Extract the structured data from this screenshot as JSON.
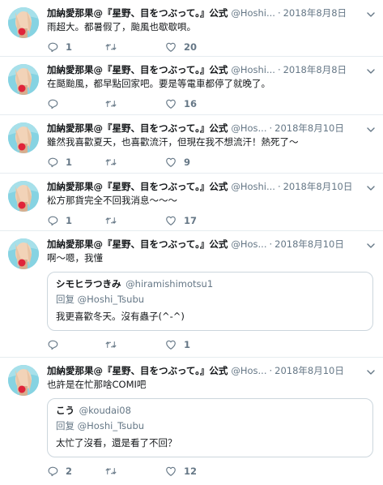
{
  "tweets": [
    {
      "name": "加納愛那果@『星野、目をつぶって。』公式",
      "handle": "@Hoshi...",
      "date": "2018年8月8日",
      "text": "雨超大。都暑假了，颱風也歇歇唄。",
      "replies": "1",
      "retweets": "",
      "likes": "20"
    },
    {
      "name": "加納愛那果@『星野、目をつぶって。』公式",
      "handle": "@Hoshi...",
      "date": "2018年8月8日",
      "text": "在颳颱風，都早點回家吧。要是等電車都停了就晚了。",
      "replies": "",
      "retweets": "",
      "likes": "16"
    },
    {
      "name": "加納愛那果@『星野、目をつぶって。』公式",
      "handle": "@Hos...",
      "date": "2018年8月10日",
      "text": "雖然我喜歡夏天，也喜歡流汗，但現在我不想流汗！熱死了～",
      "replies": "1",
      "retweets": "",
      "likes": "9"
    },
    {
      "name": "加納愛那果@『星野、目をつぶって。』公式",
      "handle": "@Hoshi...",
      "date": "2018年8月10日",
      "text": "松方那貨完全不回我消息～～～",
      "replies": "1",
      "retweets": "",
      "likes": "17"
    },
    {
      "name": "加納愛那果@『星野、目をつぶって。』公式",
      "handle": "@Hos...",
      "date": "2018年8月10日",
      "text": "啊～嗯，我懂",
      "replies": "",
      "retweets": "",
      "likes": "1",
      "quote": {
        "name": "シモヒラつきみ",
        "handle": "@hiramishimotsu1",
        "reply_prefix": "回复",
        "reply_to": "@Hoshi_Tsubu",
        "text": "我更喜歡冬天。沒有蟲子(^-^)"
      }
    },
    {
      "name": "加納愛那果@『星野、目をつぶって。』公式",
      "handle": "@Hos...",
      "date": "2018年8月10日",
      "text": "也許是在忙那啥COMI吧",
      "replies": "2",
      "retweets": "",
      "likes": "12",
      "quote": {
        "name": "こう",
        "handle": "@koudai08",
        "reply_prefix": "回复",
        "reply_to": "@Hoshi_Tsubu",
        "text": "太忙了沒看，還是看了不回？"
      }
    }
  ],
  "separator": "·",
  "colors": {
    "text": "#14171a",
    "muted": "#657786",
    "border": "#e6ecf0",
    "quote_border": "#ccd6dd",
    "avatar_bg": "#7fd0e0"
  },
  "icons": [
    "avatar",
    "chevron-down-icon",
    "reply-icon",
    "retweet-icon",
    "like-icon"
  ]
}
